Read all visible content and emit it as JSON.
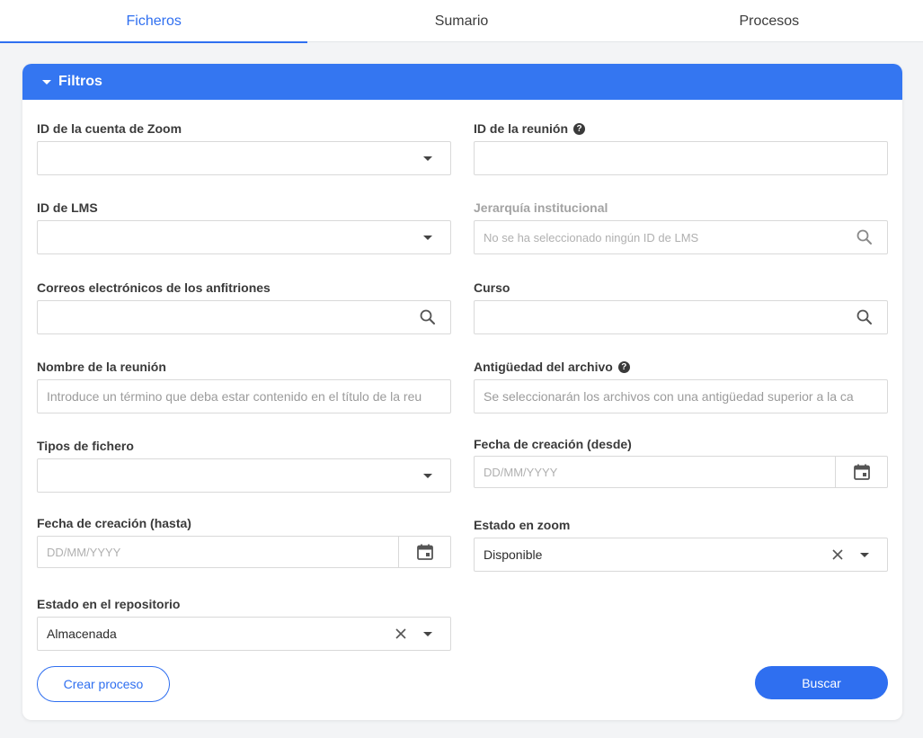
{
  "tabs": [
    {
      "label": "Ficheros"
    },
    {
      "label": "Sumario"
    },
    {
      "label": "Procesos"
    }
  ],
  "filters": {
    "title": "Filtros",
    "zoom_account": {
      "label": "ID de la cuenta de Zoom",
      "value": ""
    },
    "meeting_id": {
      "label": "ID de la reunión",
      "value": ""
    },
    "lms_id": {
      "label": "ID de LMS",
      "value": ""
    },
    "hierarchy": {
      "label": "Jerarquía institucional",
      "placeholder": "No se ha seleccionado ningún ID de LMS"
    },
    "host_emails": {
      "label": "Correos electrónicos de los anfitriones",
      "value": ""
    },
    "course": {
      "label": "Curso",
      "value": ""
    },
    "meeting_name": {
      "label": "Nombre de la reunión",
      "placeholder": "Introduce un término que deba estar contenido en el título de la reu"
    },
    "file_age": {
      "label": "Antigüedad del archivo",
      "placeholder": "Se seleccionarán los archivos con una antigüedad superior a la ca"
    },
    "file_types": {
      "label": "Tipos de fichero",
      "value": ""
    },
    "created_from": {
      "label": "Fecha de creación (desde)",
      "placeholder": "DD/MM/YYYY"
    },
    "created_to": {
      "label": "Fecha de creación (hasta)",
      "placeholder": "DD/MM/YYYY"
    },
    "zoom_status": {
      "label": "Estado en zoom",
      "value": "Disponible"
    },
    "repo_status": {
      "label": "Estado en el repositorio",
      "value": "Almacenada"
    }
  },
  "actions": {
    "create_label": "Crear proceso",
    "search_label": "Buscar"
  },
  "colors": {
    "accent": "#2f6ff0",
    "header": "#3476f1"
  }
}
